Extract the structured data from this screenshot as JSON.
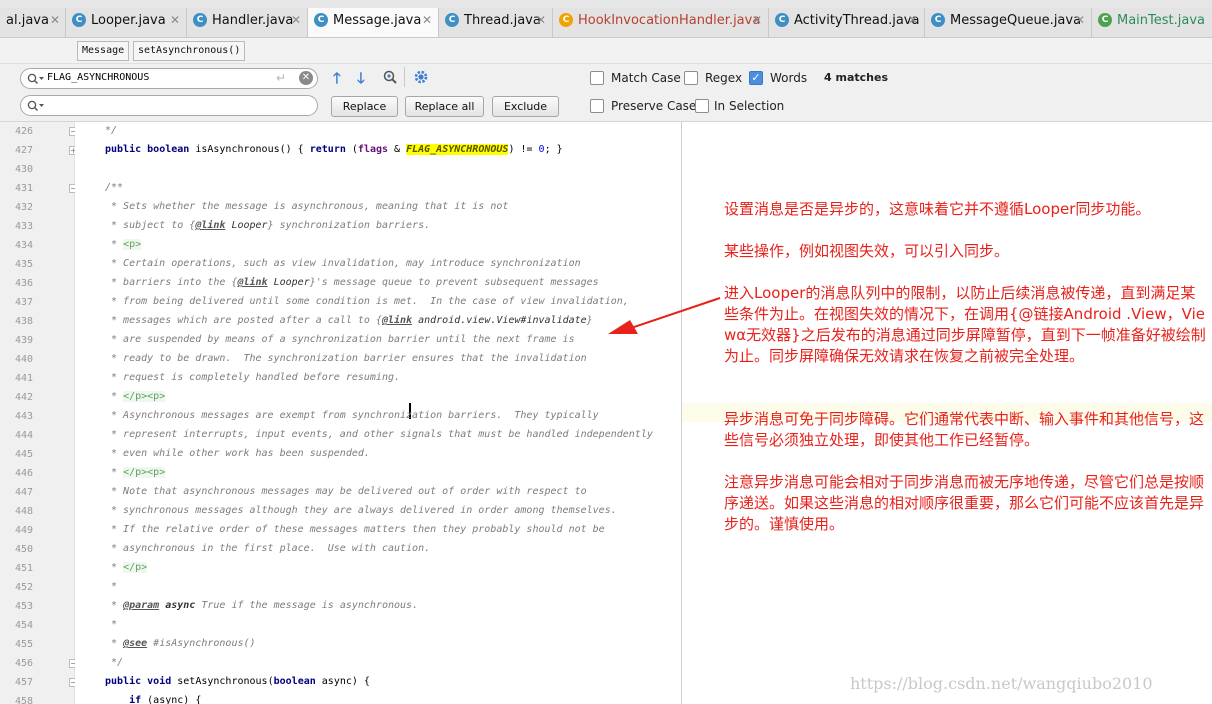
{
  "tabs": [
    {
      "label": "al.java",
      "icon": "class-icon"
    },
    {
      "label": "Looper.java",
      "icon": "class-icon"
    },
    {
      "label": "Handler.java",
      "icon": "class-icon"
    },
    {
      "label": "Message.java",
      "icon": "class-icon",
      "active": true
    },
    {
      "label": "Thread.java",
      "icon": "class-icon"
    },
    {
      "label": "HookInvocationHandler.java",
      "icon": "class-icon"
    },
    {
      "label": "ActivityThread.java",
      "icon": "class-icon"
    },
    {
      "label": "MessageQueue.java",
      "icon": "class-icon"
    },
    {
      "label": "MainTest.java",
      "icon": "class-icon"
    }
  ],
  "breadcrumb": [
    "Message",
    "setAsynchronous()"
  ],
  "find": {
    "search_value": "FLAG_ASYNCHRONOUS",
    "replace_value": "",
    "replace_label": "Replace",
    "replace_all_label": "Replace all",
    "exclude_label": "Exclude",
    "match_case_label": "Match Case",
    "regex_label": "Regex",
    "words_label": "Words",
    "preserve_case_label": "Preserve Case",
    "in_selection_label": "In Selection",
    "matches": "4 matches",
    "match_case_checked": false,
    "regex_checked": false,
    "words_checked": true
  },
  "code_lines": [
    {
      "n": "426",
      "text": "*/"
    },
    {
      "n": "427",
      "text": "public boolean isAsynchronous() { return (flags & FLAG_ASYNCHRONOUS) != 0; }"
    },
    {
      "n": "430",
      "text": ""
    },
    {
      "n": "431",
      "text": "/**"
    },
    {
      "n": "432",
      "text": " * Sets whether the message is asynchronous, meaning that it is not"
    },
    {
      "n": "433",
      "text": " * subject to {@link Looper} synchronization barriers."
    },
    {
      "n": "434",
      "text": " * <p>"
    },
    {
      "n": "435",
      "text": " * Certain operations, such as view invalidation, may introduce synchronization"
    },
    {
      "n": "436",
      "text": " * barriers into the {@link Looper}'s message queue to prevent subsequent messages"
    },
    {
      "n": "437",
      "text": " * from being delivered until some condition is met.  In the case of view invalidation,"
    },
    {
      "n": "438",
      "text": " * messages which are posted after a call to {@link android.view.View#invalidate}"
    },
    {
      "n": "439",
      "text": " * are suspended by means of a synchronization barrier until the next frame is"
    },
    {
      "n": "440",
      "text": " * ready to be drawn.  The synchronization barrier ensures that the invalidation"
    },
    {
      "n": "441",
      "text": " * request is completely handled before resuming."
    },
    {
      "n": "442",
      "text": " * </p><p>"
    },
    {
      "n": "443",
      "text": " * Asynchronous messages are exempt from synchronization barriers.  They typically"
    },
    {
      "n": "444",
      "text": " * represent interrupts, input events, and other signals that must be handled independently"
    },
    {
      "n": "445",
      "text": " * even while other work has been suspended."
    },
    {
      "n": "446",
      "text": " * </p><p>"
    },
    {
      "n": "447",
      "text": " * Note that asynchronous messages may be delivered out of order with respect to"
    },
    {
      "n": "448",
      "text": " * synchronous messages although they are always delivered in order among themselves."
    },
    {
      "n": "449",
      "text": " * If the relative order of these messages matters then they probably should not be"
    },
    {
      "n": "450",
      "text": " * asynchronous in the first place.  Use with caution."
    },
    {
      "n": "451",
      "text": " * </p>"
    },
    {
      "n": "452",
      "text": " *"
    },
    {
      "n": "453",
      "text": " * @param async True if the message is asynchronous."
    },
    {
      "n": "454",
      "text": " *"
    },
    {
      "n": "455",
      "text": " * @see #isAsynchronous()"
    },
    {
      "n": "456",
      "text": " */"
    },
    {
      "n": "457",
      "text": "public void setAsynchronous(boolean async) {"
    },
    {
      "n": "458",
      "text": "    if (async) {"
    }
  ],
  "annotation": [
    "设置消息是否是异步的，这意味着它并不遵循Looper同步功能。",
    "某些操作，例如视图失效，可以引入同步。",
    "进入Looper的消息队列中的限制，以防止后续消息被传递，直到满足某些条件为止。在视图失效的情况下，在调用{@链接Android .View，Viewα无效器}之后发布的消息通过同步屏障暂停，直到下一帧准备好被绘制为止。同步屏障确保无效请求在恢复之前被完全处理。",
    "异步消息可免于同步障碍。它们通常代表中断、输入事件和其他信号，这些信号必须独立处理，即使其他工作已经暂停。",
    "注意异步消息可能会相对于同步消息而被无序地传递，尽管它们总是按顺序递送。如果这些消息的相对顺序很重要，那么它们可能不应该首先是异步的。谨慎使用。"
  ],
  "watermark": "https://blog.csdn.net/wangqiubo2010",
  "colors": {
    "annotation": "#e8211b",
    "match_highlight": "#ffff00",
    "arrow": "#e8211b"
  }
}
